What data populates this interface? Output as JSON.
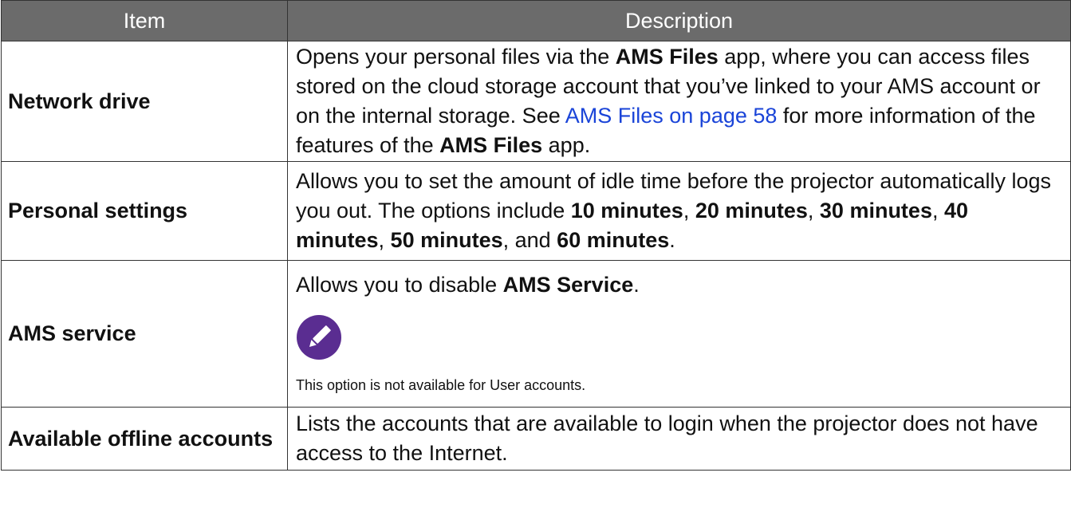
{
  "header": {
    "item": "Item",
    "description": "Description"
  },
  "rows": [
    {
      "item": "Network drive",
      "d1": "Opens your personal files via the ",
      "d2": "AMS Files",
      "d3": " app, where you can access files stored on the cloud storage account that you’ve linked to your AMS account or on the internal storage. See ",
      "link": "AMS Files on page 58",
      "d4": " for more information of the features of the ",
      "d5": "AMS Files",
      "d6": " app."
    },
    {
      "item": "Personal settings",
      "d1": "Allows you to set the amount of idle time before the projector automatically logs you out. The options include ",
      "o1": "10 minutes",
      "o2": "20 minutes",
      "o3": "30 minutes",
      "o4": "40 minutes",
      "o5": "50 minutes",
      "o6": "60 minutes",
      "sep": ", ",
      "and": ", and ",
      "end": "."
    },
    {
      "item": "AMS service",
      "d1": "Allows you to disable ",
      "d2": "AMS Service",
      "d3": ".",
      "note_icon": "pencil-note-icon",
      "note": "This option is not available for User accounts."
    },
    {
      "item": "Available offline accounts",
      "d1": "Lists the accounts that are available to login when the projector does not have access to the Internet."
    }
  ],
  "colors": {
    "header_bg": "#6b6b6b",
    "link": "#1a44d8",
    "note_icon": "#5a2d91"
  }
}
